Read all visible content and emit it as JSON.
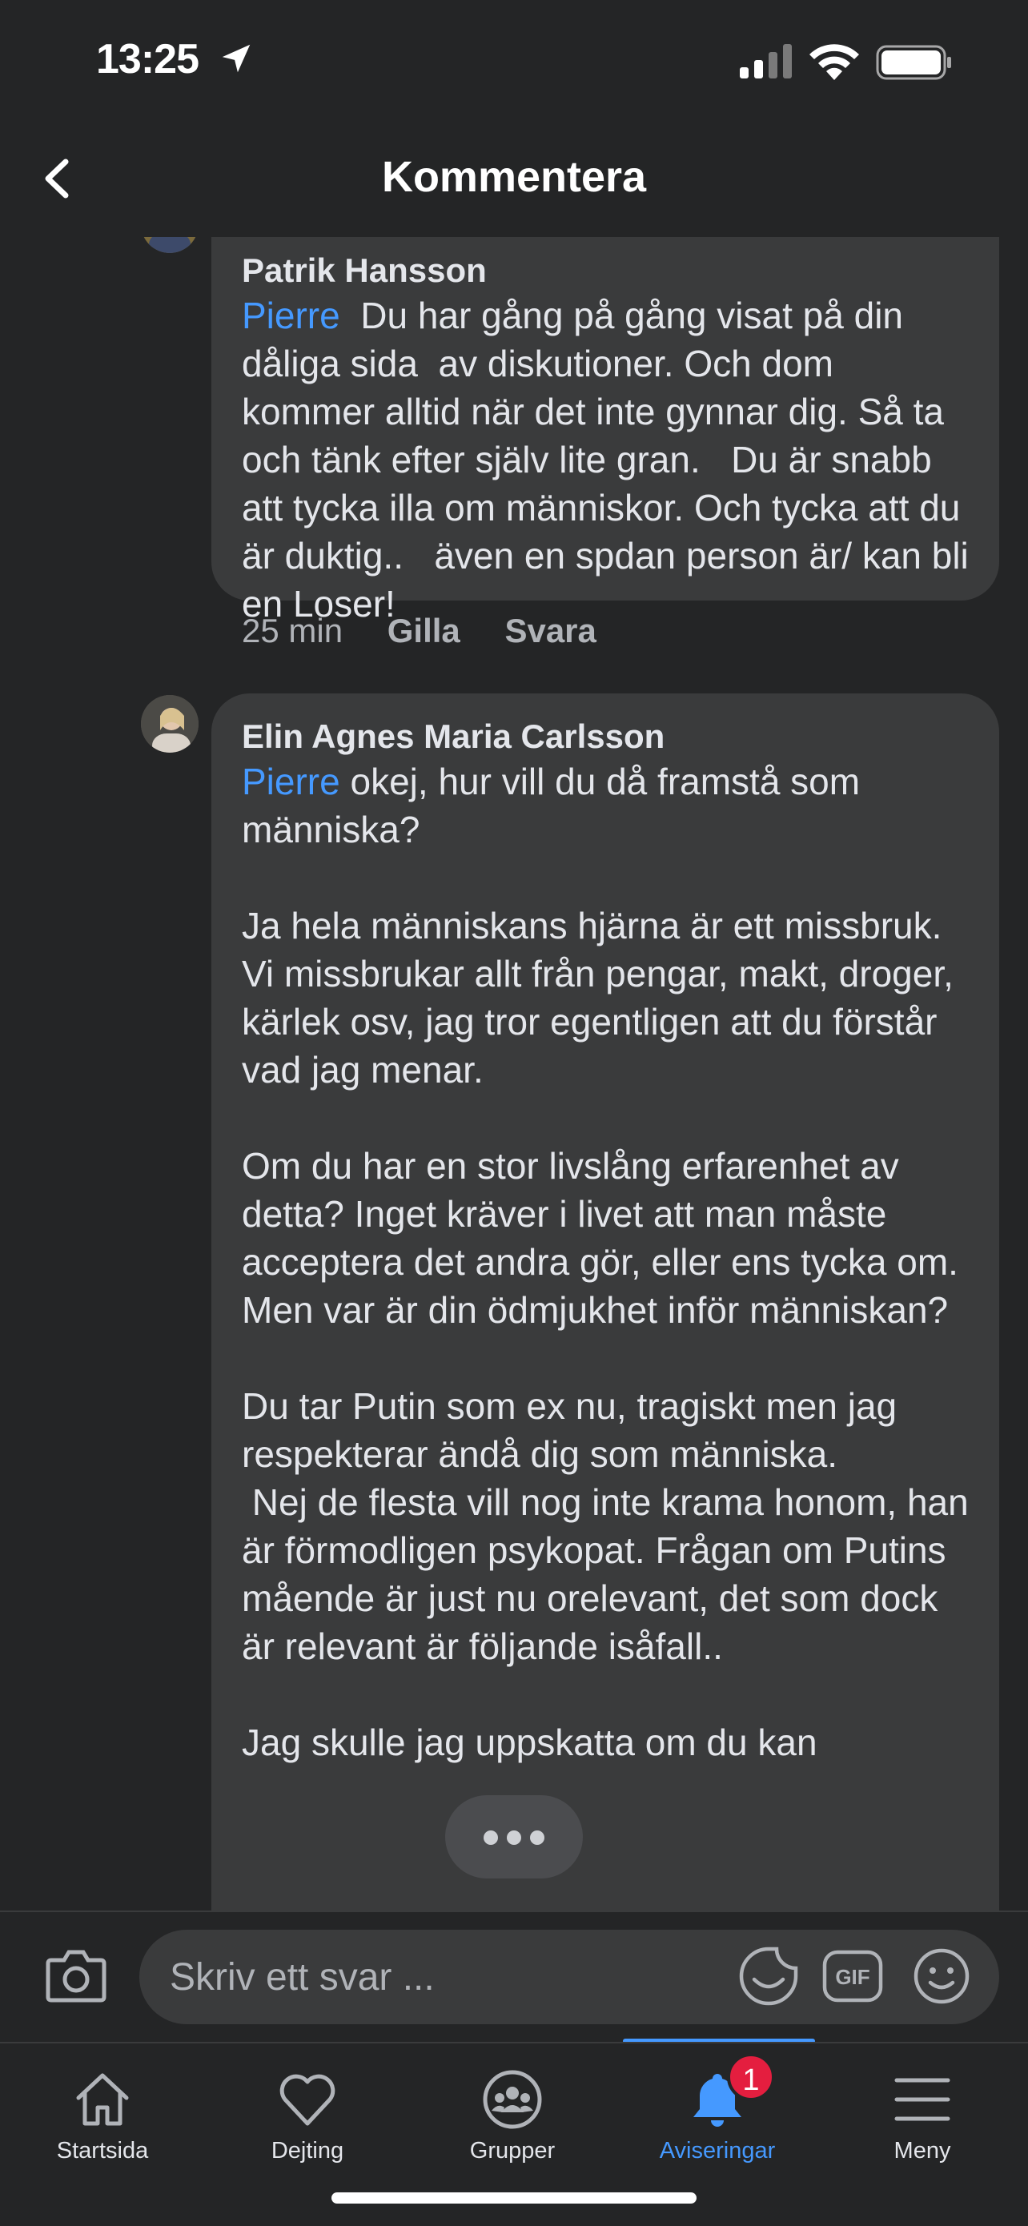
{
  "status_bar": {
    "time": "13:25"
  },
  "header": {
    "title": "Kommentera"
  },
  "comments": [
    {
      "author": "Patrik Hansson",
      "mention": "Pierre",
      "text": "  Du har gång på gång visat på din dåliga sida  av diskutioner. Och dom kommer alltid när det inte gynnar dig. Så ta och tänk efter själv lite gran.   Du är snabb att tycka illa om människor. Och tycka att du är duktig..   även en spdan person är/ kan bli en Loser!",
      "time": "25 min",
      "like_label": "Gilla",
      "reply_label": "Svara"
    },
    {
      "author": "Elin Agnes Maria Carlsson",
      "mention": "Pierre",
      "text": " okej, hur vill du då framstå som människa?\n\nJa hela människans hjärna är ett missbruk. Vi missbrukar allt från pengar, makt, droger, kärlek osv, jag tror egentligen att du förstår vad jag menar.\n\nOm du har en stor livslång erfarenhet av detta? Inget kräver i livet att man måste acceptera det andra gör, eller ens tycka om. Men var är din ödmjukhet inför människan?\n\nDu tar Putin som ex nu, tragiskt men jag respekterar ändå dig som människa.\n Nej de flesta vill nog inte krama honom, han är förmodligen psykopat. Frågan om Putins mående är just nu orelevant, det som dock är relevant är följande isåfall..\n\nJag skulle jag uppskatta om du kan"
    }
  ],
  "reply": {
    "placeholder": "Skriv ett svar ..."
  },
  "tabs": [
    {
      "label": "Startsida",
      "icon": "home-icon"
    },
    {
      "label": "Dejting",
      "icon": "heart-icon"
    },
    {
      "label": "Grupper",
      "icon": "groups-icon"
    },
    {
      "label": "Aviseringar",
      "icon": "bell-icon",
      "badge": "1",
      "active": true
    },
    {
      "label": "Meny",
      "icon": "menu-icon"
    }
  ],
  "colors": {
    "background": "#242526",
    "bubble": "#3a3b3c",
    "accent": "#4599ff",
    "badge": "#e41e3f"
  }
}
